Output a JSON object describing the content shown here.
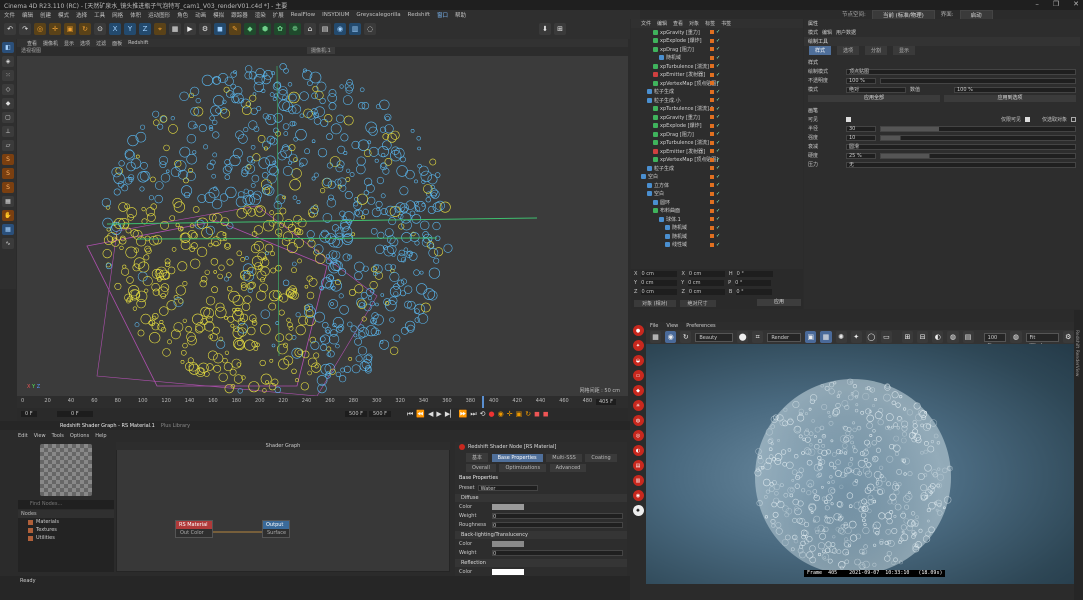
{
  "window": {
    "title": "Cinema 4D R23.110 (RC) - [天然矿泉水_镜头推进瓶子气泡特写_cam1_V03_renderV01.c4d *] - 主要",
    "controls": [
      "–",
      "❐",
      "✕"
    ]
  },
  "menubar": {
    "items": [
      "文件",
      "编辑",
      "创建",
      "模式",
      "选择",
      "工具",
      "网格",
      "体积",
      "运动图形",
      "角色",
      "动画",
      "模拟",
      "跟踪器",
      "渲染",
      "扩展",
      "RealFlow",
      "INSYDIUM",
      "Greyscalegorilla",
      "Redshift",
      "窗口",
      "帮助"
    ],
    "highlight_index": 19
  },
  "layout_switch": {
    "node_space_label": "节点空间:",
    "node_space_value": "当前 (标准/物理)",
    "interface_label": "界面:",
    "interface_value": "启动"
  },
  "viewport": {
    "menu": [
      "查看",
      "摄像机",
      "显示",
      "选项",
      "过滤",
      "面板",
      "Redshift"
    ],
    "header": "透视视图",
    "camera": "摄像机.1",
    "grid_label": "网格间距 : 50 cm",
    "axis": {
      "x": "X",
      "y": "Y",
      "z": "Z"
    }
  },
  "timeline": {
    "ticks": [
      "0",
      "20",
      "40",
      "60",
      "80",
      "100",
      "120",
      "140",
      "160",
      "180",
      "200",
      "220",
      "240",
      "260",
      "280",
      "300",
      "320",
      "340",
      "360",
      "380",
      "400",
      "420",
      "440",
      "460",
      "480"
    ],
    "current_frame": "405",
    "end_label": "405 F",
    "start_field": "0 F",
    "start_field2": "0 F",
    "end_field": "500 F",
    "end_field2": "500 F"
  },
  "panel_tabs": {
    "tabs": [
      "Redshift Shader Graph - RS Material.1",
      "Plus Library"
    ]
  },
  "shader_graph": {
    "menu": [
      "Edit",
      "View",
      "Tools",
      "Options",
      "Help"
    ],
    "title": "Shader Graph",
    "find_placeholder": "Find Nodes...",
    "nodes_header": "Nodes",
    "nodes_list": [
      "Materials",
      "Textures",
      "Utilities"
    ],
    "node_rs": {
      "title": "RS Material",
      "port": "Out Color"
    },
    "node_out": {
      "title": "Output",
      "port": "Surface"
    }
  },
  "shader_props": {
    "title": "Redshift Shader Node [RS Material]",
    "tabs_row1": [
      "基本",
      "Base Properties",
      "Multi-SSS",
      "Coating"
    ],
    "tabs_row2": [
      "Overall",
      "Optimizations",
      "Advanced"
    ],
    "section": "Base Properties",
    "preset_label": "Preset",
    "preset_value": "Water",
    "diffuse": "Diffuse",
    "color_label": "Color",
    "weight_label": "Weight",
    "weight_value": "0",
    "roughness_label": "Roughness",
    "roughness_value": "0",
    "backlight": "Back-lighting/Translucency",
    "bl_color": "Color",
    "bl_weight": "Weight",
    "bl_weight_value": "0",
    "reflection": "Reflection",
    "refl_color": "Color"
  },
  "objects": {
    "menu": [
      "文件",
      "编辑",
      "查看",
      "对象",
      "标签",
      "书签"
    ],
    "rows": [
      {
        "name": "xpGravity [重力]",
        "indent": 12,
        "icon": "g"
      },
      {
        "name": "xpExplode [爆炸]",
        "indent": 12,
        "icon": "g"
      },
      {
        "name": "xpDrag [阻力]",
        "indent": 12,
        "icon": "g"
      },
      {
        "name": "随机域",
        "indent": 18,
        "icon": "b"
      },
      {
        "name": "xpTurbulence [湍流]",
        "indent": 12,
        "icon": "g"
      },
      {
        "name": "xpEmitter [发射器]",
        "indent": 12,
        "icon": "r"
      },
      {
        "name": "xpVertexMap [顶点贴图]",
        "indent": 12,
        "icon": "g"
      },
      {
        "name": "粒子生成",
        "indent": 6,
        "icon": "b"
      },
      {
        "name": "粒子生成.小",
        "indent": 6,
        "icon": "b"
      },
      {
        "name": "xpTurbulence [湍流].1",
        "indent": 12,
        "icon": "g"
      },
      {
        "name": "xpGravity [重力]",
        "indent": 12,
        "icon": "g"
      },
      {
        "name": "xpExplode [爆炸]",
        "indent": 12,
        "icon": "g"
      },
      {
        "name": "xpDrag [阻力]",
        "indent": 12,
        "icon": "g"
      },
      {
        "name": "xpTurbulence [湍流]",
        "indent": 12,
        "icon": "g"
      },
      {
        "name": "xpEmitter [发射器]",
        "indent": 12,
        "icon": "r"
      },
      {
        "name": "xpVertexMap [顶点贴图]",
        "indent": 12,
        "icon": "g"
      },
      {
        "name": "粒子生成",
        "indent": 6,
        "icon": "b"
      },
      {
        "name": "空白",
        "indent": 0,
        "icon": "b"
      },
      {
        "name": "立方体",
        "indent": 6,
        "icon": "b"
      },
      {
        "name": "空白",
        "indent": 6,
        "icon": "b"
      },
      {
        "name": "圆环",
        "indent": 12,
        "icon": "b"
      },
      {
        "name": "布料曲面",
        "indent": 12,
        "icon": "g"
      },
      {
        "name": "球体.1",
        "indent": 18,
        "icon": "b"
      },
      {
        "name": "随机域",
        "indent": 24,
        "icon": "b"
      },
      {
        "name": "随机域",
        "indent": 24,
        "icon": "b"
      },
      {
        "name": "线性域",
        "indent": 24,
        "icon": "b"
      }
    ]
  },
  "coords": {
    "rows": [
      {
        "a": "X",
        "av": "0 cm",
        "b": "X",
        "bv": "0 cm",
        "c": "H",
        "cv": "0 °"
      },
      {
        "a": "Y",
        "av": "0 cm",
        "b": "Y",
        "bv": "0 cm",
        "c": "P",
        "cv": "0 °"
      },
      {
        "a": "Z",
        "av": "0 cm",
        "b": "Z",
        "bv": "0 cm",
        "c": "B",
        "cv": "0 °"
      }
    ],
    "mode1": "对象 (相对)",
    "mode2": "绝对尺寸",
    "apply": "应用"
  },
  "attributes": {
    "title": "属性",
    "menu": [
      "模式",
      "编辑",
      "用户数据"
    ],
    "tool": "绘制工具",
    "tabs": [
      "样式",
      "选项",
      "分割",
      "显示"
    ],
    "draw_mode_label": "绘制模式",
    "draw_mode_value": "顶点贴图",
    "opacity_label": "不透明度",
    "opacity_value": "100 %",
    "mode_label": "模式",
    "mode_value": "绝对",
    "value_label": "数值",
    "value_value": "100 %",
    "apply_all": "应用全部",
    "apply_selected": "应用到选项",
    "brush_section": "画笔",
    "visible_only_label": "可见",
    "visible_only2": "仅限可见",
    "selected_only": "仅选取对象",
    "radius_label": "半径",
    "radius_value": "30",
    "strength_label": "强度",
    "strength_value": "10",
    "falloff_label": "衰减",
    "falloff_value": "圆滑",
    "stretch_label": "硬度",
    "stretch_value": "25 %",
    "pressure_label": "压力",
    "pressure_value": "无"
  },
  "render_view": {
    "menu": [
      "File",
      "View",
      "Preferences"
    ],
    "dropdown1": "Beauty",
    "dropdown2": "Render",
    "zoom": "100 %",
    "fit": "Fit Window",
    "stamp": "Frame  405    2021-09-07  10:33:10   (18.09s)",
    "side_label": "Redshift RenderView"
  },
  "status": {
    "text": "Ready"
  }
}
